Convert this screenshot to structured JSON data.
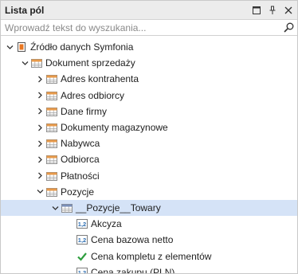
{
  "panel": {
    "title": "Lista pól"
  },
  "search": {
    "placeholder": "Wprowadź tekst do wyszukania..."
  },
  "tree": [
    {
      "label": "Źródło danych Symfonia",
      "icon": "datasource-icon",
      "expander": "expanded",
      "level": 0
    },
    {
      "label": "Dokument sprzedaży",
      "icon": "table-icon",
      "expander": "expanded",
      "level": 1
    },
    {
      "label": "Adres kontrahenta",
      "icon": "table-icon",
      "expander": "collapsed",
      "level": 2
    },
    {
      "label": "Adres odbiorcy",
      "icon": "table-icon",
      "expander": "collapsed",
      "level": 2
    },
    {
      "label": "Dane firmy",
      "icon": "table-icon",
      "expander": "collapsed",
      "level": 2
    },
    {
      "label": "Dokumenty magazynowe",
      "icon": "table-icon",
      "expander": "collapsed",
      "level": 2
    },
    {
      "label": "Nabywca",
      "icon": "table-icon",
      "expander": "collapsed",
      "level": 2
    },
    {
      "label": "Odbiorca",
      "icon": "table-icon",
      "expander": "collapsed",
      "level": 2
    },
    {
      "label": "Płatności",
      "icon": "table-icon",
      "expander": "collapsed",
      "level": 2
    },
    {
      "label": "Pozycje",
      "icon": "table-icon",
      "expander": "expanded",
      "level": 2
    },
    {
      "label": "__Pozycje__Towary",
      "icon": "relation-table-icon",
      "expander": "expanded",
      "level": 3,
      "selected": true
    },
    {
      "label": "Akcyza",
      "icon": "number-field-icon",
      "expander": "none",
      "level": 4
    },
    {
      "label": "Cena bazowa netto",
      "icon": "number-field-icon",
      "expander": "none",
      "level": 4
    },
    {
      "label": "Cena kompletu z elementów",
      "icon": "checkmark-field-icon",
      "expander": "none",
      "level": 4
    },
    {
      "label": "Cena zakupu (PLN)",
      "icon": "number-field-icon",
      "expander": "none",
      "level": 4
    }
  ],
  "colors": {
    "selection": "#d5e3f7",
    "table_header": "#e89a4a",
    "datasource": "#e87722",
    "number_icon": "#2b6cb0",
    "check_icon": "#2e9e3e"
  }
}
